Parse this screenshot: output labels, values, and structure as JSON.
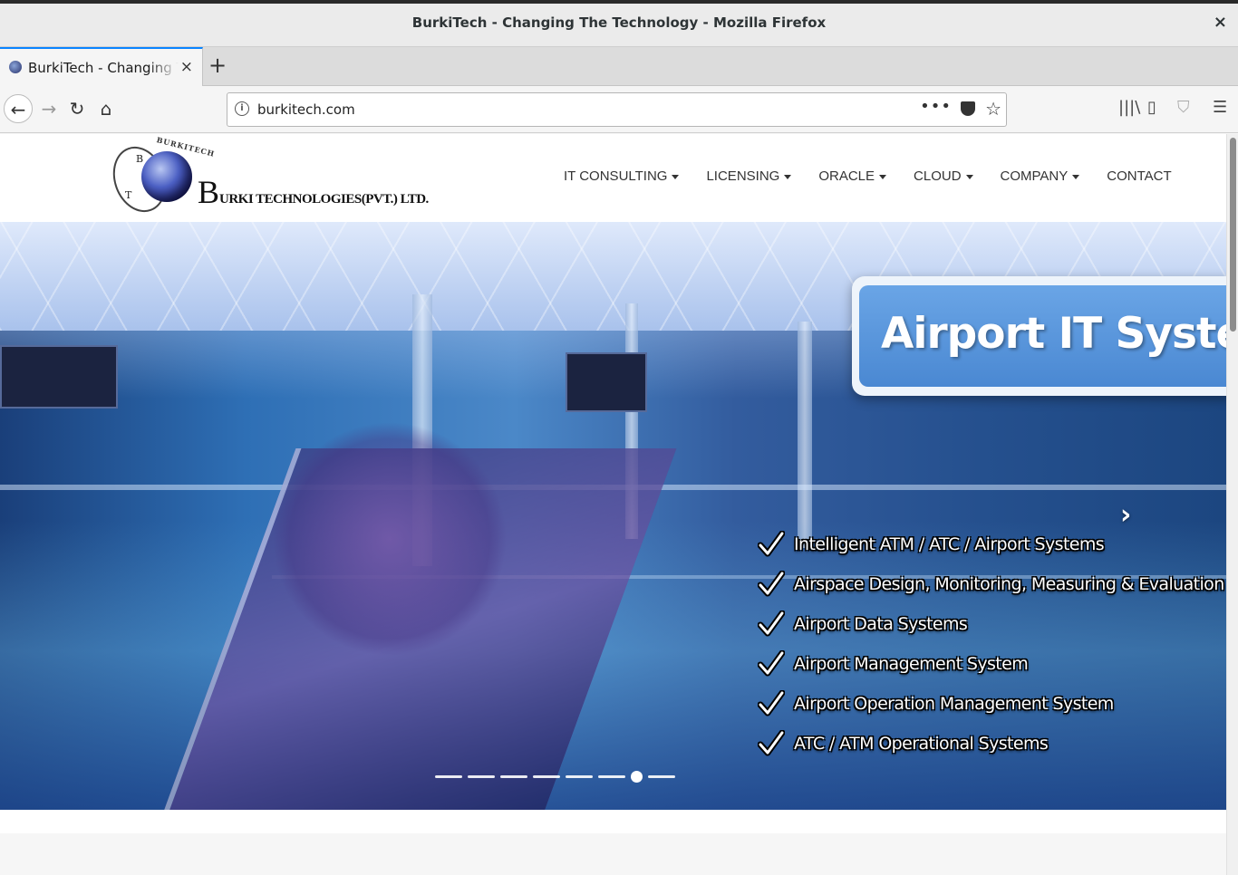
{
  "window": {
    "title": "BurkiTech - Changing The Technology - Mozilla Firefox",
    "close_glyph": "×"
  },
  "tabs": [
    {
      "label": "BurkiTech - Changing The Technology",
      "close_glyph": "×"
    }
  ],
  "newtab_glyph": "+",
  "toolbar": {
    "url": "burkitech.com",
    "back_glyph": "←",
    "forward_glyph": "→",
    "reload_glyph": "↻",
    "home_glyph": "⌂",
    "page_actions_glyph": "•••",
    "star_glyph": "☆",
    "library_glyph": "|||\\",
    "sidebar_glyph": "▯",
    "shield_glyph": "⛉",
    "menu_glyph": "☰"
  },
  "site": {
    "logo": {
      "arc_text": "BURKITECH",
      "letter_b": "B",
      "letter_t": "T",
      "brand_initial": "B",
      "brand_rest": "URKI TECHNOLOGIES(PVT.) LTD."
    },
    "nav": [
      {
        "label": "IT CONSULTING",
        "dropdown": true
      },
      {
        "label": "LICENSING",
        "dropdown": true
      },
      {
        "label": "ORACLE",
        "dropdown": true
      },
      {
        "label": "CLOUD",
        "dropdown": true
      },
      {
        "label": "COMPANY",
        "dropdown": true
      },
      {
        "label": "CONTACT",
        "dropdown": false
      }
    ]
  },
  "hero": {
    "banner_title": "Airport IT System",
    "features": [
      "Intelligent ATM / ATC / Airport Systems",
      "Airspace Design, Monitoring, Measuring & Evaluation",
      "Airport Data Systems",
      "Airport Management System",
      "Airport Operation Management System",
      "ATC / ATM Operational Systems"
    ],
    "next_glyph": "›",
    "slides_total": 8,
    "active_slide_index": 6
  },
  "colors": {
    "tab_accent": "#0a84ff",
    "banner_blue": "#4a88d2",
    "nav_text": "#333333"
  }
}
